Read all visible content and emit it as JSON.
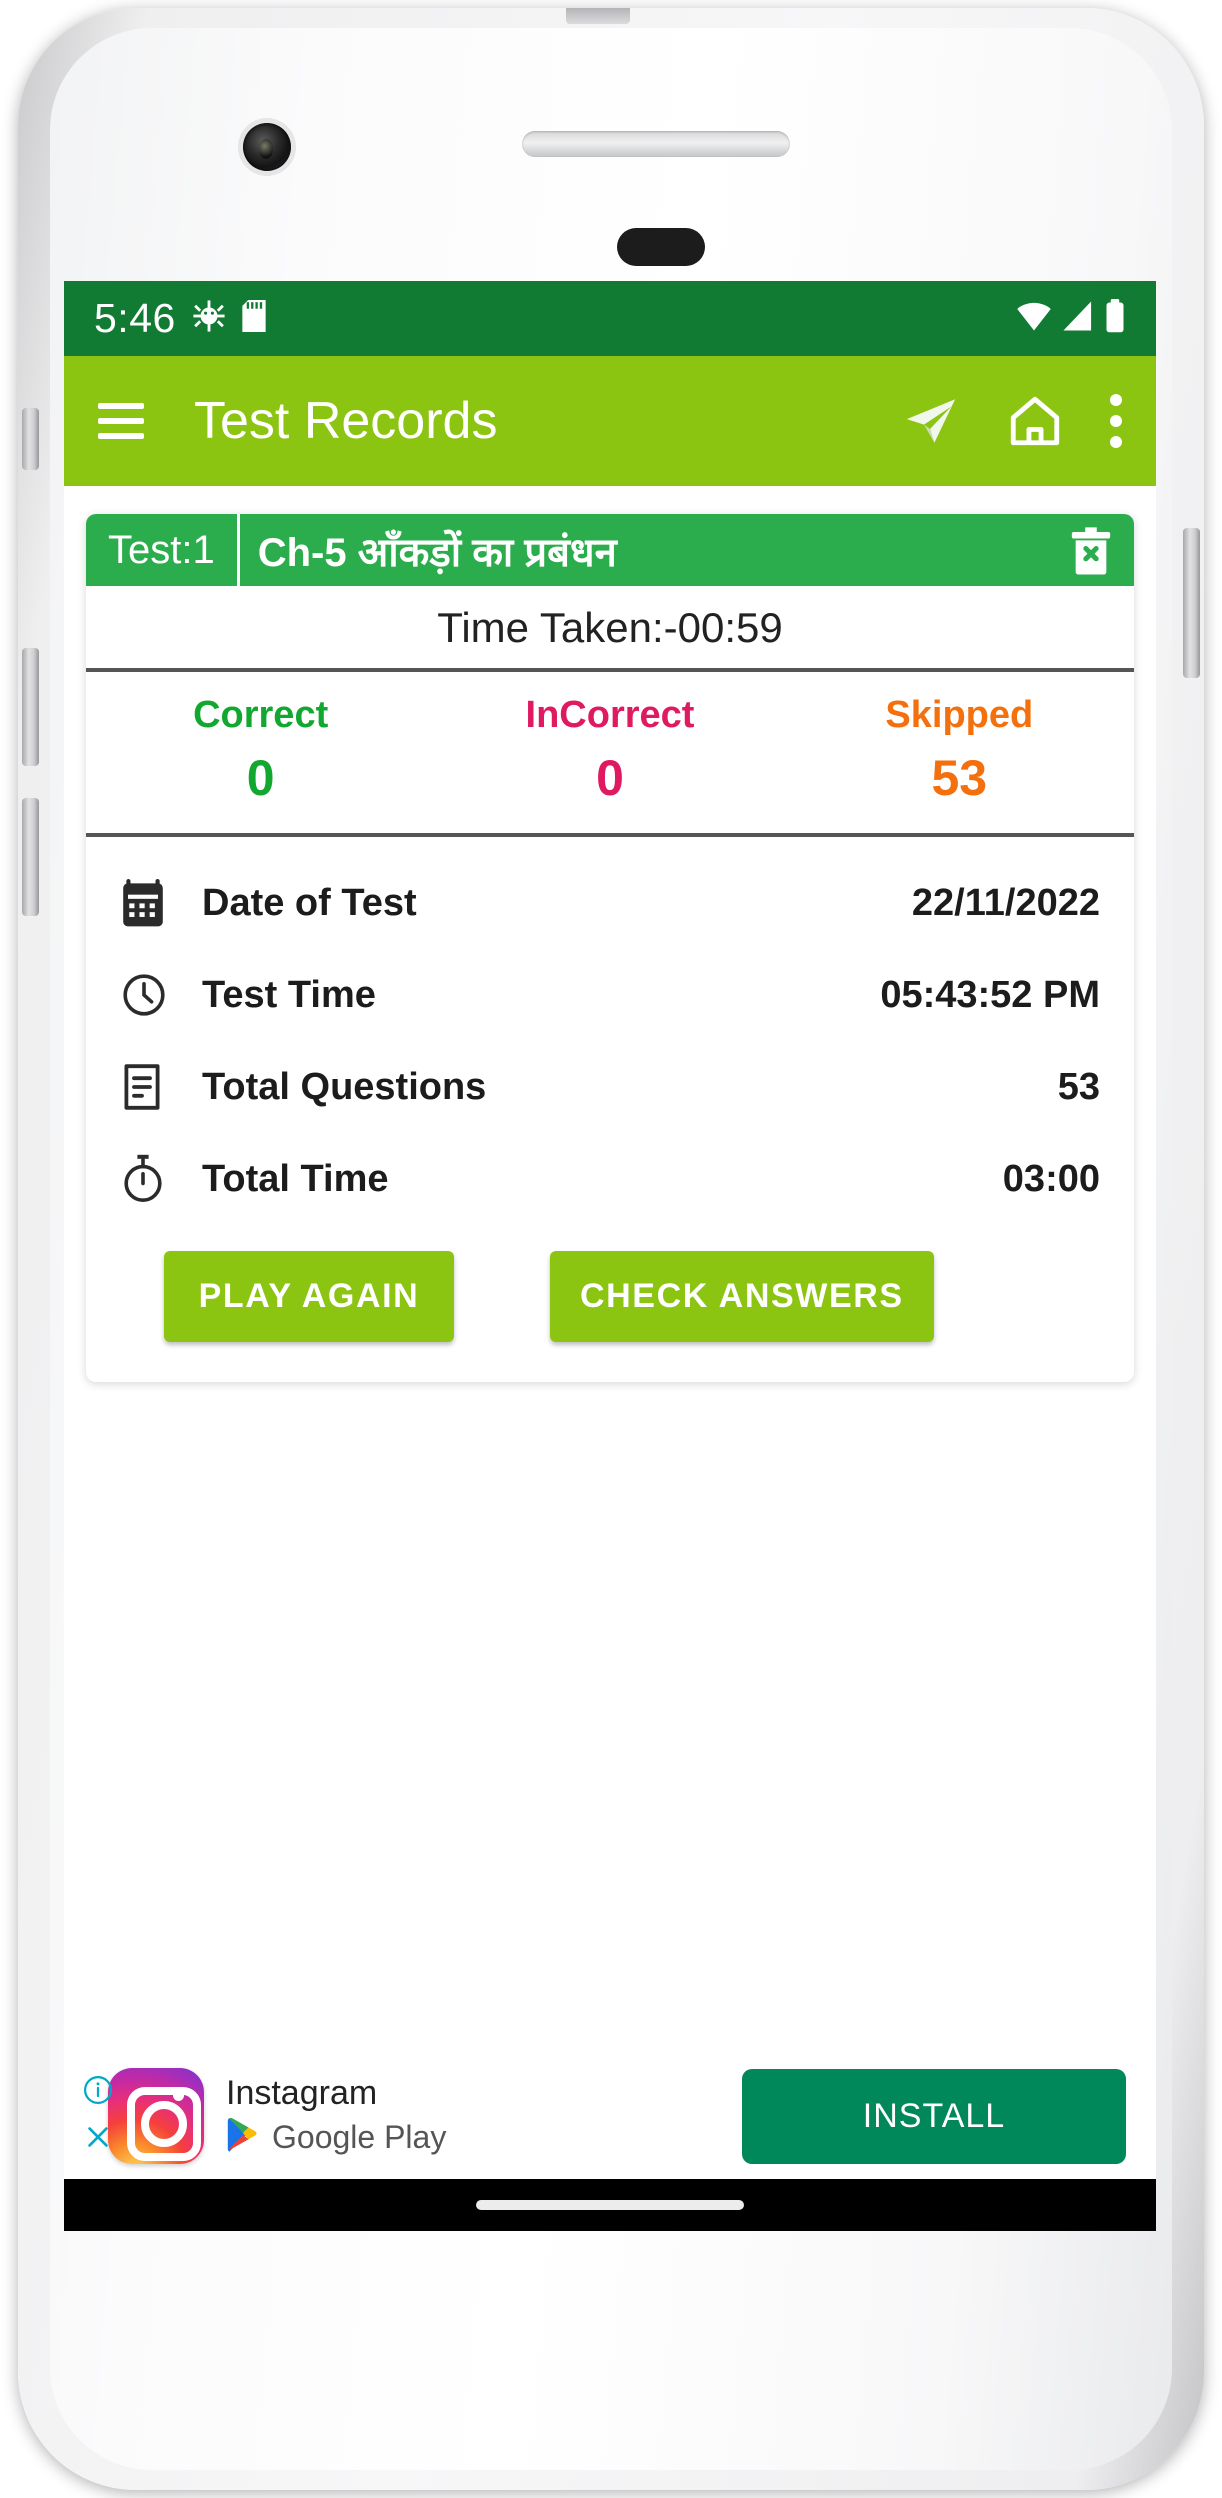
{
  "status_bar": {
    "time": "5:46",
    "icons": [
      "android-debug-icon",
      "sd-card-icon"
    ],
    "right_icons": [
      "wifi-icon",
      "signal-icon",
      "battery-icon"
    ],
    "background": "#117a33"
  },
  "app_bar": {
    "title": "Test Records",
    "menu_icon": "hamburger-menu-icon",
    "actions": [
      "share-icon",
      "home-icon",
      "overflow-menu-icon"
    ],
    "background": "#8cc412"
  },
  "record_card": {
    "test_label": "Test:1",
    "chapter": "Ch-5 आँकड़ों का प्रबंधन",
    "delete_icon": "delete-trash-icon",
    "header_background": "#2cad4d",
    "time_taken": "Time Taken:-00:59",
    "scores": [
      {
        "label": "Correct",
        "value": "0",
        "color": "#12a830"
      },
      {
        "label": "InCorrect",
        "value": "0",
        "color": "#e01a60"
      },
      {
        "label": "Skipped",
        "value": "53",
        "color": "#f4700c"
      }
    ],
    "details": [
      {
        "icon": "calendar-icon",
        "label": "Date of Test",
        "value": "22/11/2022"
      },
      {
        "icon": "clock-icon",
        "label": "Test Time",
        "value": "05:43:52 PM"
      },
      {
        "icon": "note-icon",
        "label": "Total Questions",
        "value": "53"
      },
      {
        "icon": "stopwatch-icon",
        "label": "Total Time",
        "value": "03:00"
      }
    ],
    "buttons": {
      "play_again": "PLAY AGAIN",
      "check_answers": "CHECK ANSWERS"
    }
  },
  "ad": {
    "info_icon": "ad-info-icon",
    "close_icon": "ad-close-icon",
    "app_icon": "instagram-icon",
    "app_name": "Instagram",
    "store_icon": "google-play-icon",
    "store_name": "Google Play",
    "install_label": "INSTALL",
    "install_color": "#00875a"
  },
  "nav_bar": {
    "gesture_handle": "home-gesture-pill"
  }
}
